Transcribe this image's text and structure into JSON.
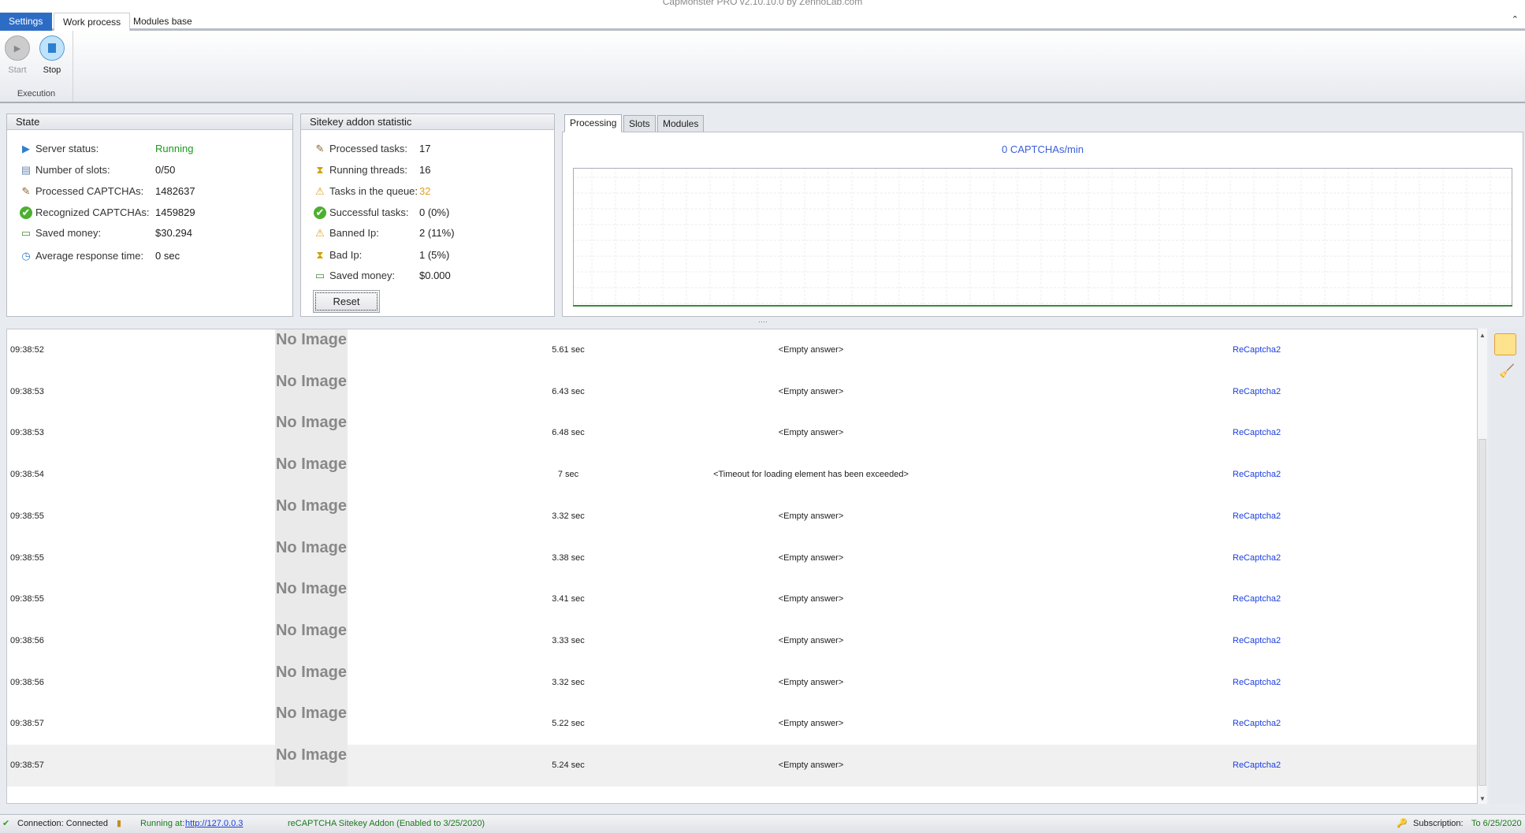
{
  "window": {
    "title": "CapMonster PRO v2.10.10.0 by ZennoLab.com"
  },
  "ribbon": {
    "tabs": [
      "Settings",
      "Work process",
      "Modules base"
    ],
    "start": "Start",
    "stop": "Stop",
    "group": "Execution"
  },
  "state": {
    "title": "State",
    "rows": [
      {
        "label": "Server status:",
        "value": "Running",
        "icon": "play-icon"
      },
      {
        "label": "Number of slots:",
        "value": "0/50",
        "icon": "slots-icon"
      },
      {
        "label": "Processed CAPTCHAs:",
        "value": "1482637",
        "icon": "edit-icon"
      },
      {
        "label": "Recognized CAPTCHAs:",
        "value": "1459829",
        "icon": "check-icon"
      },
      {
        "label": "Saved money:",
        "value": "$30.294",
        "icon": "money-icon"
      },
      {
        "label": "Average response time:",
        "value": "0 sec",
        "icon": "clock-icon"
      }
    ]
  },
  "sitekey": {
    "title": "Sitekey addon statistic",
    "rows": [
      {
        "label": "Processed tasks:",
        "value": "17",
        "icon": "edit-icon"
      },
      {
        "label": "Running threads:",
        "value": "16",
        "icon": "hourglass-icon"
      },
      {
        "label": "Tasks in the queue:",
        "value": "32",
        "icon": "warning-icon"
      },
      {
        "label": "Successful tasks:",
        "value": "0 (0%)",
        "icon": "check-icon"
      },
      {
        "label": "Banned Ip:",
        "value": "2 (11%)",
        "icon": "warning-icon"
      },
      {
        "label": "Bad Ip:",
        "value": "1 (5%)",
        "icon": "hourglass-icon"
      },
      {
        "label": "Saved money:",
        "value": "$0.000",
        "icon": "money-icon"
      }
    ],
    "reset": "Reset"
  },
  "chart_tabs": [
    "Processing",
    "Slots",
    "Modules"
  ],
  "chart_data": {
    "type": "line",
    "title": "0 CAPTCHAs/min",
    "series": [
      {
        "name": "CAPTCHAs/min",
        "values": [
          0,
          0
        ]
      }
    ],
    "grid": true,
    "ylim": [
      0,
      1
    ]
  },
  "log": {
    "no_image": "No Image",
    "rows": [
      {
        "time": "09:38:52",
        "duration": "5.61 sec",
        "answer": "<Empty answer>",
        "type": "ReCaptcha2"
      },
      {
        "time": "09:38:53",
        "duration": "6.43 sec",
        "answer": "<Empty answer>",
        "type": "ReCaptcha2"
      },
      {
        "time": "09:38:53",
        "duration": "6.48 sec",
        "answer": "<Empty answer>",
        "type": "ReCaptcha2"
      },
      {
        "time": "09:38:54",
        "duration": "7 sec",
        "answer": "<Timeout for loading element has been exceeded>",
        "type": "ReCaptcha2"
      },
      {
        "time": "09:38:55",
        "duration": "3.32 sec",
        "answer": "<Empty answer>",
        "type": "ReCaptcha2"
      },
      {
        "time": "09:38:55",
        "duration": "3.38 sec",
        "answer": "<Empty answer>",
        "type": "ReCaptcha2"
      },
      {
        "time": "09:38:55",
        "duration": "3.41 sec",
        "answer": "<Empty answer>",
        "type": "ReCaptcha2"
      },
      {
        "time": "09:38:56",
        "duration": "3.33 sec",
        "answer": "<Empty answer>",
        "type": "ReCaptcha2"
      },
      {
        "time": "09:38:56",
        "duration": "3.32 sec",
        "answer": "<Empty answer>",
        "type": "ReCaptcha2"
      },
      {
        "time": "09:38:57",
        "duration": "5.22 sec",
        "answer": "<Empty answer>",
        "type": "ReCaptcha2"
      },
      {
        "time": "09:38:57",
        "duration": "5.24 sec",
        "answer": "<Empty answer>",
        "type": "ReCaptcha2"
      }
    ]
  },
  "status": {
    "connection": "Connection: Connected",
    "running_at": "Running at:",
    "url": "http://127.0.0.3",
    "addon": "reCAPTCHA Sitekey Addon (Enabled to 3/25/2020)",
    "subscription": "Subscription:",
    "subscription_to": "To 6/25/2020"
  },
  "colors": {
    "running": "#1a9a1a",
    "queue": "#e0a020",
    "link": "#1a3ee0",
    "accent": "#2d6cc4"
  }
}
